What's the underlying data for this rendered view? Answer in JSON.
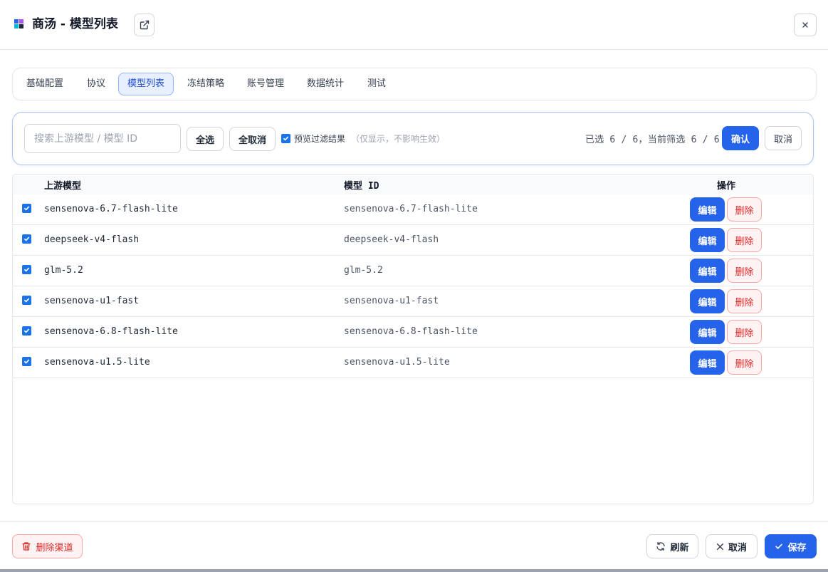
{
  "header": {
    "title": "商汤 - 模型列表",
    "icons": {
      "external": "external-link-icon",
      "close": "close-icon"
    }
  },
  "tabs": [
    {
      "label": "基础配置",
      "active": false
    },
    {
      "label": "协议",
      "active": false
    },
    {
      "label": "模型列表",
      "active": true
    },
    {
      "label": "冻结策略",
      "active": false
    },
    {
      "label": "账号管理",
      "active": false
    },
    {
      "label": "数据统计",
      "active": false
    },
    {
      "label": "测试",
      "active": false
    }
  ],
  "filter": {
    "search_placeholder": "搜索上游模型 / 模型 ID",
    "select_all": "全选",
    "deselect_all": "全取消",
    "preview_label": "预览过滤结果",
    "preview_hint": "（仅显示，不影响生效）",
    "preview_checked": true,
    "count_text": "已选 6 / 6，当前筛选 6 / 6",
    "confirm": "确认",
    "cancel": "取消"
  },
  "table": {
    "columns": [
      "上游模型",
      "模型 ID",
      "操作"
    ],
    "edit_label": "编辑",
    "delete_label": "删除",
    "rows": [
      {
        "checked": true,
        "upstream": "sensenova-6.7-flash-lite",
        "model_id": "sensenova-6.7-flash-lite"
      },
      {
        "checked": true,
        "upstream": "deepseek-v4-flash",
        "model_id": "deepseek-v4-flash"
      },
      {
        "checked": true,
        "upstream": "glm-5.2",
        "model_id": "glm-5.2"
      },
      {
        "checked": true,
        "upstream": "sensenova-u1-fast",
        "model_id": "sensenova-u1-fast"
      },
      {
        "checked": true,
        "upstream": "sensenova-6.8-flash-lite",
        "model_id": "sensenova-6.8-flash-lite"
      },
      {
        "checked": true,
        "upstream": "sensenova-u1.5-lite",
        "model_id": "sensenova-u1.5-lite"
      }
    ]
  },
  "footer": {
    "delete_channel": "删除渠道",
    "refresh": "刷新",
    "cancel": "取消",
    "save": "保存"
  },
  "colors": {
    "primary": "#2563eb",
    "danger": "#dc2626",
    "tab_active_bg": "#e8efff"
  }
}
